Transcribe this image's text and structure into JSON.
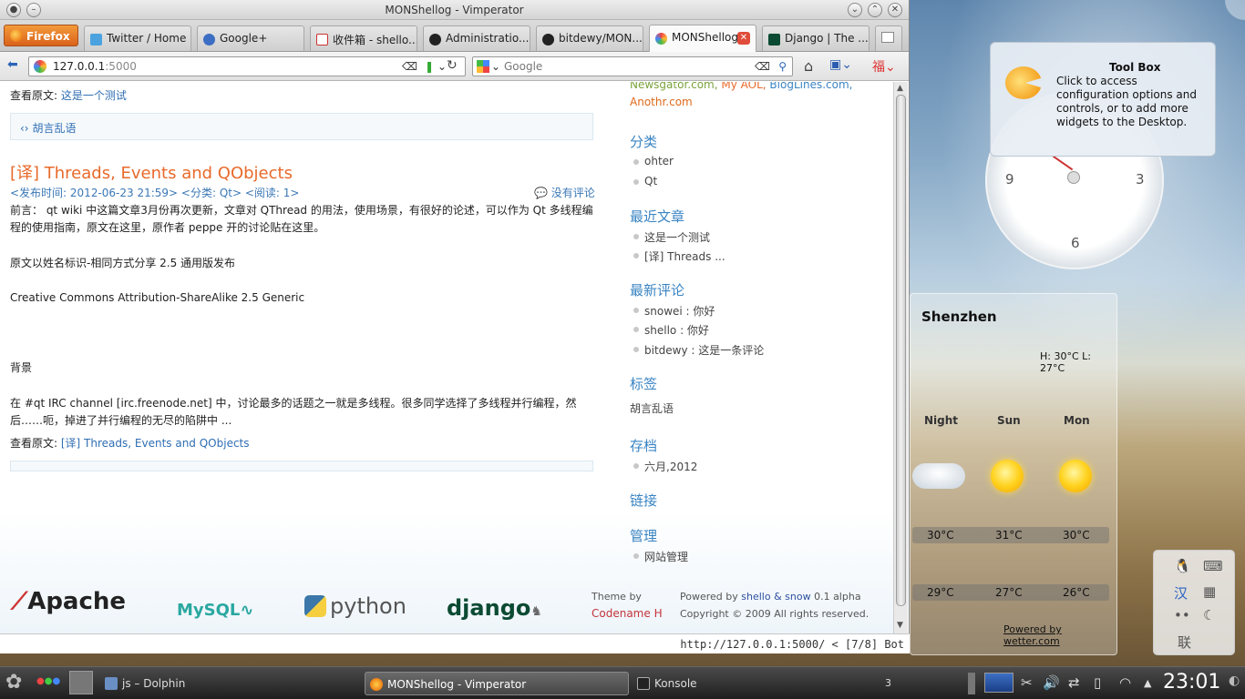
{
  "window": {
    "title": "MONShellog - Vimperator"
  },
  "firefox_button": "Firefox",
  "tabs": [
    {
      "label": "Twitter / Home"
    },
    {
      "label": "Google+"
    },
    {
      "label": "收件箱 - shello..."
    },
    {
      "label": "Administratio..."
    },
    {
      "label": "bitdewy/MON..."
    },
    {
      "label": "MONShellog"
    },
    {
      "label": "Django | The ..."
    }
  ],
  "nav": {
    "url_host": "127.0.0.1",
    "url_port": ":5000",
    "search_placeholder": "Google"
  },
  "content": {
    "top_read_prefix": "查看原文:",
    "top_read_link": "这是一个测试",
    "tag_box_1": "胡言乱语",
    "post_title": "[译] Threads, Events and QObjects",
    "post_meta": "<发布时间: 2012-06-23 21:59> <分类: Qt> <阅读: 1>",
    "post_comments": "没有评论",
    "para1": "前言： qt wiki 中这篇文章3月份再次更新，文章对 QThread 的用法，使用场景，有很好的论述，可以作为 Qt 多线程编程的使用指南，原文在这里，原作者 peppe 开的讨论贴在这里。",
    "para2": "原文以姓名标识-相同方式分享 2.5 通用版发布",
    "para3": "Creative Commons Attribution-ShareAlike 2.5 Generic",
    "para4": "背景",
    "para5": "在 #qt IRC channel [irc.freenode.net] 中，讨论最多的话题之一就是多线程。很多同学选择了多线程并行编程，然后……呃，掉进了并行编程的无尽的陷阱中 ...",
    "bottom_read_prefix": "查看原文:",
    "bottom_read_link": "[译] Threads, Events and QObjects"
  },
  "sidebar": {
    "feeds_1a": "Newsgator.com,",
    "feeds_1b": "My AOL,",
    "feeds_1c": "BlogLines.com,",
    "feeds_2": "Anothr.com",
    "categories_title": "分类",
    "categories": [
      "ohter",
      "Qt"
    ],
    "recent_title": "最近文章",
    "recent": [
      "这是一个测试",
      "[译] Threads ..."
    ],
    "comments_title": "最新评论",
    "comments": [
      "snowei : 你好",
      "shello : 你好",
      "bitdewy : 这是一条评论"
    ],
    "tags_title": "标签",
    "tags": "胡言乱语",
    "archive_title": "存档",
    "archive": [
      "六月,2012"
    ],
    "links_title": "链接",
    "admin_title": "管理",
    "admin": [
      "网站管理"
    ]
  },
  "footer": {
    "logo_apache": "Apache",
    "logo_mysql": "MySQL",
    "logo_python": "python",
    "logo_django": "django",
    "theme_by": "Theme by",
    "codename": "Codename H",
    "powered_prefix": "Powered by",
    "powered_link": "shello & snow",
    "powered_ver": "0.1 alpha",
    "copyright": "Copyright © 2009 All rights reserved."
  },
  "statusbar": "http://127.0.0.1:5000/ < [7/8] Bot",
  "toolbox": {
    "title": "Tool Box",
    "desc": "Click to access configuration options and controls, or to add more widgets to the Desktop."
  },
  "clock": {
    "n9": "9",
    "n3": "3",
    "n6": "6"
  },
  "weather": {
    "city": "Shenzhen",
    "hilo": "H: 30°C L: 27°C",
    "days": [
      "Night",
      "Sun",
      "Mon"
    ],
    "high": [
      "30°C",
      "31°C",
      "30°C"
    ],
    "low": [
      "29°C",
      "27°C",
      "26°C"
    ],
    "powered": "Powered by wetter.com"
  },
  "input_panel": {
    "han": "汉",
    "lian": "联"
  },
  "taskbar": {
    "tasks": [
      "js – Dolphin",
      "MONShellog - Vimperator",
      "Konsole"
    ],
    "konsole_badge": "3",
    "time": "23:01"
  },
  "colors": {
    "accent": "#2f6eb3",
    "title_orange": "#e8692a",
    "heading_blue": "#3a84c3"
  }
}
